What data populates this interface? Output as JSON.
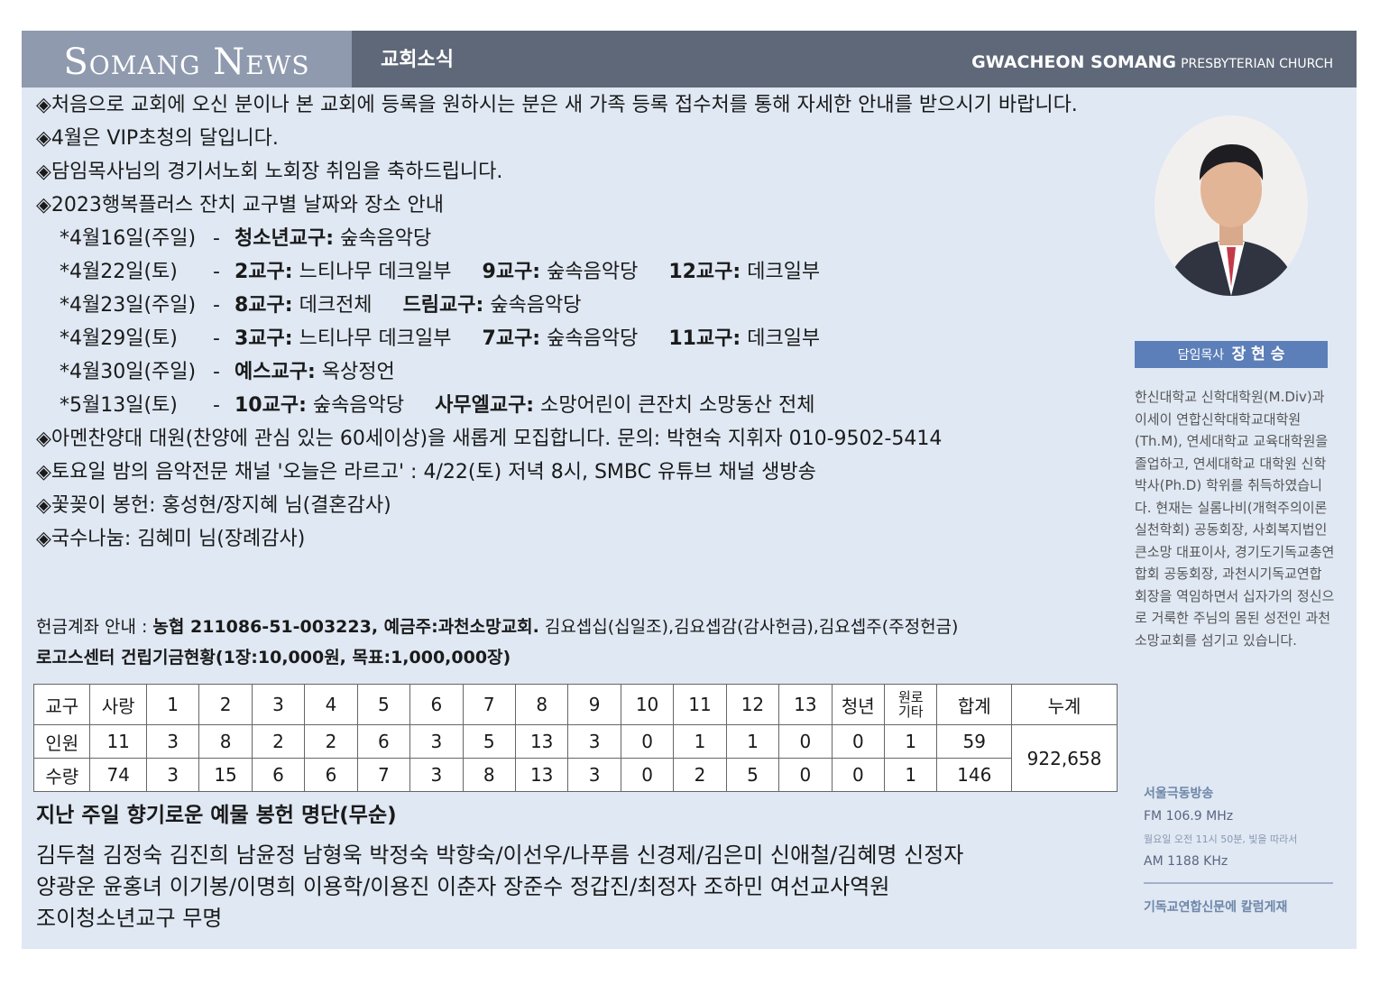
{
  "header": {
    "brand": "Somang News",
    "section": "교회소식",
    "church_bold": "GWACHEON SOMANG",
    "church_rest": "PRESBYTERIAN CHURCH"
  },
  "notices": [
    "◈처음으로 교회에 오신 분이나 본 교회에 등록을 원하시는 분은 새 가족 등록 접수처를 통해 자세한 안내를 받으시기 바랍니다.",
    "◈4월은 VIP초청의 달입니다.",
    "◈담임목사님의 경기서노회 노회장 취임을 축하드립니다.",
    "◈2023행복플러스 잔치 교구별 날짜와 장소 안내"
  ],
  "schedule": [
    {
      "date": "*4월16일(주일)",
      "dash": "-",
      "entries": [
        {
          "group": "청소년교구:",
          "place": " 숲속음악당"
        }
      ]
    },
    {
      "date": "*4월22일(토)",
      "dash": "-",
      "entries": [
        {
          "group": "2교구:",
          "place": " 느티나무 데크일부"
        },
        {
          "group": "9교구:",
          "place": " 숲속음악당"
        },
        {
          "group": "12교구:",
          "place": " 데크일부"
        }
      ]
    },
    {
      "date": "*4월23일(주일)",
      "dash": "-",
      "entries": [
        {
          "group": "8교구:",
          "place": " 데크전체"
        },
        {
          "group": "드림교구:",
          "place": " 숲속음악당"
        }
      ]
    },
    {
      "date": "*4월29일(토)",
      "dash": "-",
      "entries": [
        {
          "group": "3교구:",
          "place": " 느티나무 데크일부"
        },
        {
          "group": "7교구:",
          "place": " 숲속음악당"
        },
        {
          "group": "11교구:",
          "place": " 데크일부"
        }
      ]
    },
    {
      "date": "*4월30일(주일)",
      "dash": "-",
      "entries": [
        {
          "group": "예스교구:",
          "place": " 옥상정언"
        }
      ]
    },
    {
      "date": "*5월13일(토)",
      "dash": "-",
      "entries": [
        {
          "group": "10교구:",
          "place": " 숲속음악당"
        },
        {
          "group": "사무엘교구:",
          "place": " 소망어린이 큰잔치 소망동산 전체"
        }
      ]
    }
  ],
  "notices2": [
    "◈아멘찬양대 대원(찬양에 관심 있는 60세이상)을 새롭게 모집합니다. 문의: 박현숙 지휘자 010-9502-5414",
    "◈토요일 밤의 음악전문 채널 '오늘은 라르고' : 4/22(토) 저녁 8시, SMBC 유튜브 채널 생방송",
    "◈꽃꽂이 봉헌: 홍성현/장지혜 님(결혼감사)",
    "◈국수나눔: 김혜미 님(장례감사)"
  ],
  "finance": {
    "label": "헌금계좌 안내 : ",
    "account": "농협 211086-51-003223, 예금주:과천소망교회.",
    "types": " 김요셉십(십일조),김요셉감(감사헌금),김요셉주(주정헌금)",
    "fund_title": "로고스센터 건립기금현황(1장:10,000원, 목표:1,000,000장)"
  },
  "fund_table": {
    "headers": [
      "교구",
      "사랑",
      "1",
      "2",
      "3",
      "4",
      "5",
      "6",
      "7",
      "8",
      "9",
      "10",
      "11",
      "12",
      "13",
      "청년",
      "원로\n기타",
      "합계",
      "누계"
    ],
    "rows": [
      {
        "label": "인원",
        "values": [
          "11",
          "3",
          "8",
          "2",
          "2",
          "6",
          "3",
          "5",
          "13",
          "3",
          "0",
          "1",
          "1",
          "0",
          "0",
          "1",
          "59"
        ]
      },
      {
        "label": "수량",
        "values": [
          "74",
          "3",
          "15",
          "6",
          "6",
          "7",
          "3",
          "8",
          "13",
          "3",
          "0",
          "2",
          "5",
          "0",
          "0",
          "1",
          "146"
        ]
      }
    ],
    "cumulative": "922,658"
  },
  "offerings": {
    "title": "지난 주일 향기로운 예물 봉헌 명단(무순)",
    "lines": [
      "김두철 김정숙 김진희 남윤정 남형욱 박정숙 박향숙/이선우/나푸름 신경제/김은미 신애철/김혜명 신정자",
      "양광운 윤홍녀 이기봉/이명희 이용학/이용진 이춘자 장준수 정갑진/최정자 조하민 여선교사역원",
      "조이청소년교구 무명"
    ]
  },
  "sidebar": {
    "pastor_title": "담임목사",
    "pastor_name": "장 현 승",
    "bio": "한신대학교 신학대학원(M.Div)과 이세이 연합신학대학교대학원(Th.M), 연세대학교 교육대학원을 졸업하고, 연세대학교 대학원 신학박사(Ph.D) 학위를 취득하였습니다. 현재는 실롬나비(개혁주의이론 실천학회) 공동회장, 사회복지법인 큰소망 대표이사, 경기도기독교총연합회 공동회장, 과천시기독교연합 회장을 역임하면서 십자가의 정신으로 거룩한 주님의 몸된 성전인 과천소망교회를 섬기고 있습니다.",
    "radio_title": "서울극동방송",
    "radio_fm": "FM 106.9 MHz",
    "radio_time": "월요일 오전 11시 50분, 빛을 따라서",
    "radio_am": "AM 1188 KHz",
    "column_note": "기독교연합신문에 칼럼게재"
  }
}
